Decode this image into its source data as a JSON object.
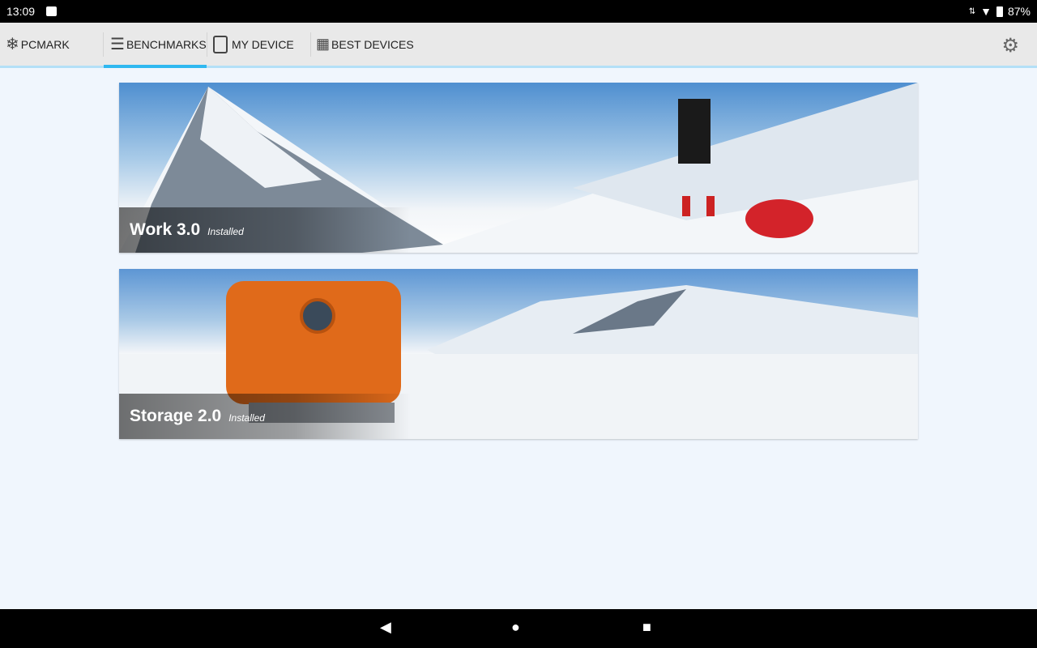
{
  "status": {
    "time": "13:09",
    "battery": "87%"
  },
  "appbar": {
    "brand": "PCMARK",
    "tabs": [
      {
        "label": "BENCHMARKS"
      },
      {
        "label": "MY DEVICE"
      },
      {
        "label": "BEST DEVICES"
      }
    ]
  },
  "benchmarks": [
    {
      "name": "Work 3.0",
      "status": "Installed"
    },
    {
      "name": "Storage 2.0",
      "status": "Installed"
    }
  ],
  "colors": {
    "accent": "#2fb8f0"
  }
}
